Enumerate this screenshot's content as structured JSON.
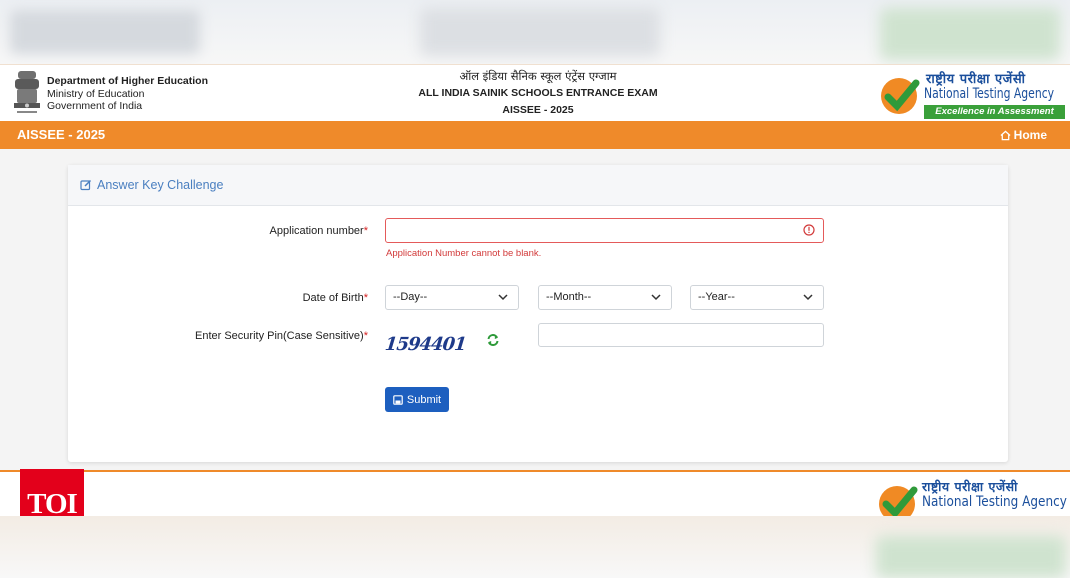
{
  "header": {
    "dept_line1": "Department of Higher Education",
    "dept_line2": "Ministry of Education",
    "dept_line3": "Government of India",
    "exam_hindi": "ऑल इंडिया सैनिक स्कूल एंट्रेंस एग्जाम",
    "exam_english": "ALL INDIA SAINIK SCHOOLS ENTRANCE EXAM",
    "exam_short": "AISSEE - 2025",
    "nta_hindi": "राष्ट्रीय परीक्षा एजेंसी",
    "nta_english": "National Testing Agency",
    "nta_tagline": "Excellence in Assessment"
  },
  "nav": {
    "brand": "AISSEE - 2025",
    "home_label": "Home"
  },
  "form": {
    "title": "Answer Key Challenge",
    "application_label": "Application number",
    "application_value": "",
    "application_error": "Application Number cannot be blank.",
    "dob_label": "Date of Birth",
    "day_selected": "--Day--",
    "month_selected": "--Month--",
    "year_selected": "--Year--",
    "pin_label": "Enter Security Pin(Case Sensitive)",
    "captcha_text": "1594401",
    "pin_value": "",
    "submit_label": "Submit",
    "required_mark": "*"
  },
  "footer": {
    "toi_logo": "TOI",
    "nta_hindi": "राष्ट्रीय परीक्षा एजेंसी",
    "nta_english": "National Testing Agency"
  },
  "colors": {
    "nav_orange": "#ef8a2a",
    "primary_blue": "#1d5fbf",
    "error_red": "#d23a3a",
    "nta_green": "#3aa03a"
  }
}
